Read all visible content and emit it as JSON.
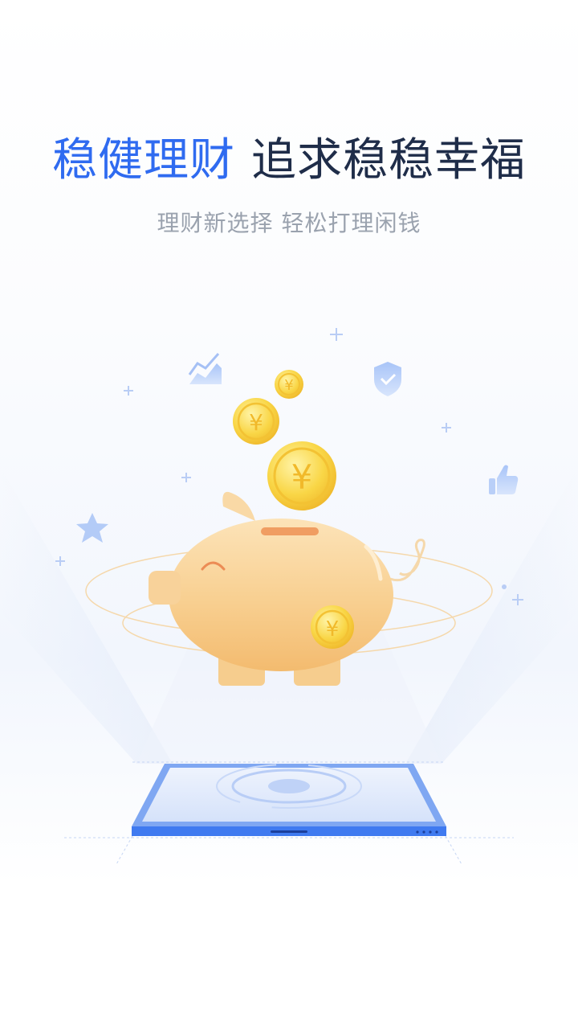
{
  "hero": {
    "title_accent": "稳健理财",
    "title_rest": "追求稳稳幸福",
    "subtitle": "理财新选择 轻松打理闲钱"
  },
  "illustration": {
    "coin_symbol": "¥",
    "icons": [
      "trend-chart-icon",
      "shield-check-icon",
      "thumbs-up-icon",
      "star-icon",
      "piggy-bank-icon",
      "phone-device-icon"
    ]
  },
  "colors": {
    "accent": "#2f6bf0",
    "title": "#1f2d49",
    "subtitle": "#9aa2ae",
    "coin": "#f7c93b",
    "pig": "#f7c98a"
  }
}
